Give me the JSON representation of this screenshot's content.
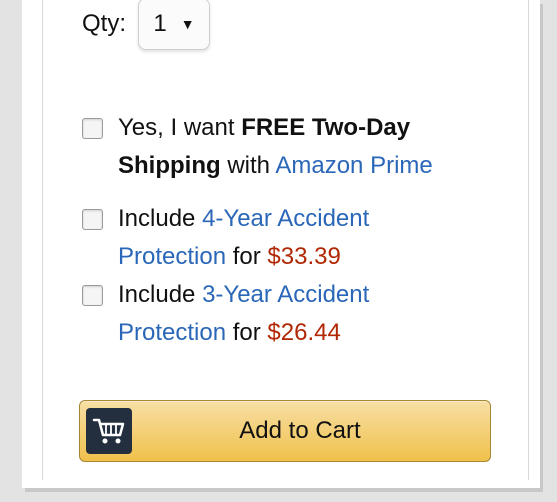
{
  "quantity": {
    "label": "Qty:",
    "value": "1",
    "arrow": "▼"
  },
  "options": [
    {
      "parts": {
        "p1": "Yes, I want ",
        "p2": "FREE Two-Day Shipping",
        "p3": " with ",
        "p4": "Amazon Prime"
      }
    },
    {
      "parts": {
        "p1": "Include ",
        "p2": "4-Year Accident Protection",
        "p3": " for ",
        "p4": "$33.39"
      }
    },
    {
      "parts": {
        "p1": "Include ",
        "p2": "3-Year Accident Protection",
        "p3": " for ",
        "p4": "$26.44"
      }
    }
  ],
  "cart_button": {
    "label": "Add to Cart",
    "icon": "cart-icon"
  },
  "colors": {
    "link": "#2a67b8",
    "price": "#b12704",
    "button_top": "#f7dfa5",
    "button_bottom": "#f0c14b",
    "icon_box": "#232f3e"
  }
}
